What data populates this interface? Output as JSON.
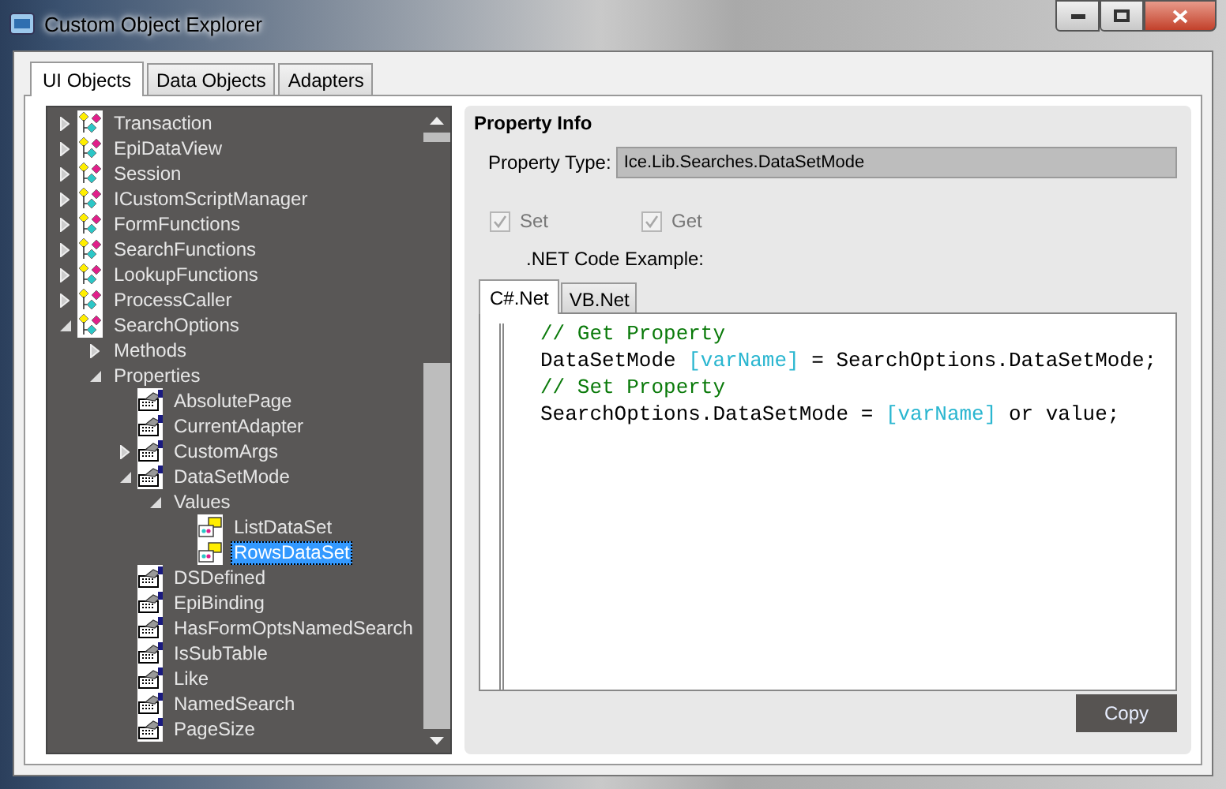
{
  "window": {
    "title": "Custom Object Explorer"
  },
  "tabs": [
    {
      "label": "UI Objects",
      "selected": true
    },
    {
      "label": "Data Objects",
      "selected": false
    },
    {
      "label": "Adapters",
      "selected": false
    }
  ],
  "tree": [
    {
      "label": "Transaction",
      "kind": "object",
      "expanded": false,
      "selected": false
    },
    {
      "label": "EpiDataView",
      "kind": "object",
      "expanded": false,
      "selected": false
    },
    {
      "label": "Session",
      "kind": "object",
      "expanded": false,
      "selected": false
    },
    {
      "label": "ICustomScriptManager",
      "kind": "object",
      "expanded": false,
      "selected": false
    },
    {
      "label": "FormFunctions",
      "kind": "object",
      "expanded": false,
      "selected": false
    },
    {
      "label": "SearchFunctions",
      "kind": "object",
      "expanded": false,
      "selected": false
    },
    {
      "label": "LookupFunctions",
      "kind": "object",
      "expanded": false,
      "selected": false
    },
    {
      "label": "ProcessCaller",
      "kind": "object",
      "expanded": false,
      "selected": false
    },
    {
      "label": "SearchOptions",
      "kind": "object",
      "expanded": true,
      "selected": false,
      "children": [
        {
          "label": "Methods",
          "expanded": false,
          "selected": false
        },
        {
          "label": "Properties",
          "expanded": true,
          "selected": false,
          "children": [
            {
              "label": "AbsolutePage",
              "kind": "property",
              "selected": false
            },
            {
              "label": "CurrentAdapter",
              "kind": "property",
              "selected": false
            },
            {
              "label": "CustomArgs",
              "kind": "property",
              "expanded": false,
              "selected": false
            },
            {
              "label": "DataSetMode",
              "kind": "property",
              "expanded": true,
              "selected": false,
              "children": [
                {
                  "label": "Values",
                  "expanded": true,
                  "selected": false,
                  "children": [
                    {
                      "label": "ListDataSet",
                      "kind": "value",
                      "selected": false
                    },
                    {
                      "label": "RowsDataSet",
                      "kind": "value",
                      "selected": true
                    }
                  ]
                }
              ]
            },
            {
              "label": "DSDefined",
              "kind": "property",
              "selected": false
            },
            {
              "label": "EpiBinding",
              "kind": "property",
              "selected": false
            },
            {
              "label": "HasFormOptsNamedSearch",
              "kind": "property",
              "selected": false
            },
            {
              "label": "IsSubTable",
              "kind": "property",
              "selected": false
            },
            {
              "label": "Like",
              "kind": "property",
              "selected": false
            },
            {
              "label": "NamedSearch",
              "kind": "property",
              "selected": false
            },
            {
              "label": "PageSize",
              "kind": "property",
              "selected": false
            }
          ]
        }
      ]
    }
  ],
  "property_info": {
    "title": "Property Info",
    "type_label": "Property Type:",
    "type_value": "Ice.Lib.Searches.DataSetMode",
    "checkboxes": [
      {
        "label": "Set",
        "checked": true,
        "disabled": true
      },
      {
        "label": "Get",
        "checked": true,
        "disabled": true
      }
    ],
    "code_example_label": ".NET Code Example:",
    "code_tabs": [
      {
        "label": "C#.Net",
        "selected": true
      },
      {
        "label": "VB.Net",
        "selected": false
      }
    ],
    "code_lines": [
      [
        {
          "text": "// Get Property",
          "kind": "comment"
        }
      ],
      [
        {
          "text": "DataSetMode ",
          "kind": "plain"
        },
        {
          "text": "[varName]",
          "kind": "placeholder"
        },
        {
          "text": " = SearchOptions.DataSetMode;",
          "kind": "plain"
        }
      ],
      [
        {
          "text": "// Set Property",
          "kind": "comment"
        }
      ],
      [
        {
          "text": "SearchOptions.DataSetMode = ",
          "kind": "plain"
        },
        {
          "text": "[varName]",
          "kind": "placeholder"
        },
        {
          "text": " or value;",
          "kind": "plain"
        }
      ]
    ],
    "copy_button": "Copy"
  }
}
